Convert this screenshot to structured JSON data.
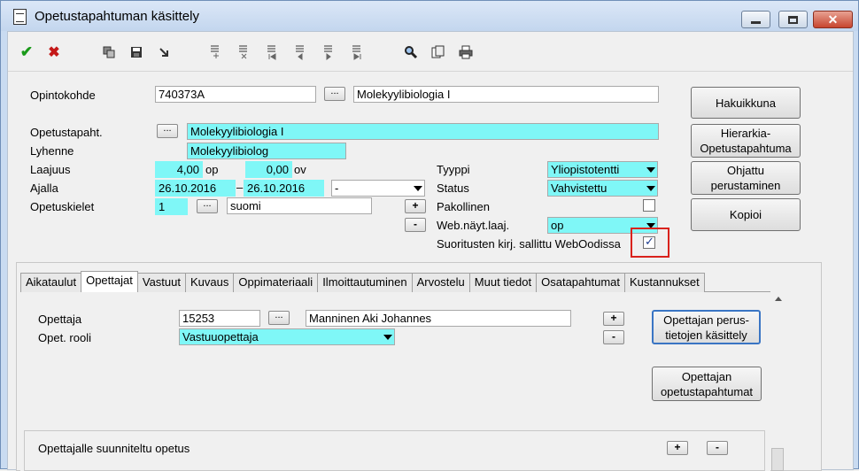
{
  "window": {
    "title": "Opetustapahtuman käsittely"
  },
  "toolbar": {
    "icons": [
      "check-icon",
      "cancel-x-icon",
      "copy-icon",
      "save-icon",
      "export-icon",
      "record-add-icon",
      "record-delete-icon",
      "record-first-icon",
      "record-prev-icon",
      "record-next-icon",
      "record-last-icon",
      "search-icon",
      "copy-document-icon",
      "print-icon"
    ]
  },
  "form": {
    "opintokohde_label": "Opintokohde",
    "opintokohde_code": "740373A",
    "opintokohde_name": "Molekyylibiologia I",
    "dots": "...",
    "opetustapaht_label": "Opetustapaht.",
    "opetustapaht_value": "Molekyylibiologia I",
    "lyhenne_label": "Lyhenne",
    "lyhenne_value": "Molekyylibiolog",
    "laajuus_label": "Laajuus",
    "laajuus_op": "4,00",
    "op_unit": "op",
    "laajuus_ov": "0,00",
    "ov_unit": "ov",
    "ajalla_label": "Ajalla",
    "ajalla_start": "26.10.2016",
    "ajalla_dash": "–",
    "ajalla_end": "26.10.2016",
    "ajalla_period": "-",
    "opetuskielet_label": "Opetuskielet",
    "opetuskielet_code": "1",
    "opetuskielet_name": "suomi",
    "plus": "+",
    "minus": "-",
    "tyyppi_label": "Tyyppi",
    "tyyppi_value": "Yliopistotentti",
    "status_label": "Status",
    "status_value": "Vahvistettu",
    "pakollinen_label": "Pakollinen",
    "webnayt_label": "Web.näyt.laaj.",
    "webnayt_value": "op",
    "suoritusten_label": "Suoritusten kirj. sallittu WebOodissa"
  },
  "side_buttons": {
    "hakuikkuna": "Hakuikkuna",
    "hierarkia_line1": "Hierarkia-",
    "hierarkia_line2": "Opetustapahtuma",
    "ohjattu_line1": "Ohjattu",
    "ohjattu_line2": "perustaminen",
    "kopioi": "Kopioi"
  },
  "tabs": [
    {
      "label": "Aikataulut"
    },
    {
      "label": "Opettajat"
    },
    {
      "label": "Vastuut"
    },
    {
      "label": "Kuvaus"
    },
    {
      "label": "Oppimateriaali"
    },
    {
      "label": "Ilmoittautuminen"
    },
    {
      "label": "Arvostelu"
    },
    {
      "label": "Muut tiedot"
    },
    {
      "label": "Osatapahtumat"
    },
    {
      "label": "Kustannukset"
    }
  ],
  "opettajat": {
    "opettaja_label": "Opettaja",
    "opettaja_code": "15253",
    "opettaja_name": "Manninen Aki Johannes",
    "rooli_label": "Opet. rooli",
    "rooli_value": "Vastuuopettaja",
    "perustiedot_line1": "Opettajan perus-",
    "perustiedot_line2": "tietojen käsittely",
    "opetustapahtumat_line1": "Opettajan",
    "opetustapahtumat_line2": "opetustapahtumat",
    "suunniteltu_label": "Opettajalle suunniteltu opetus"
  }
}
